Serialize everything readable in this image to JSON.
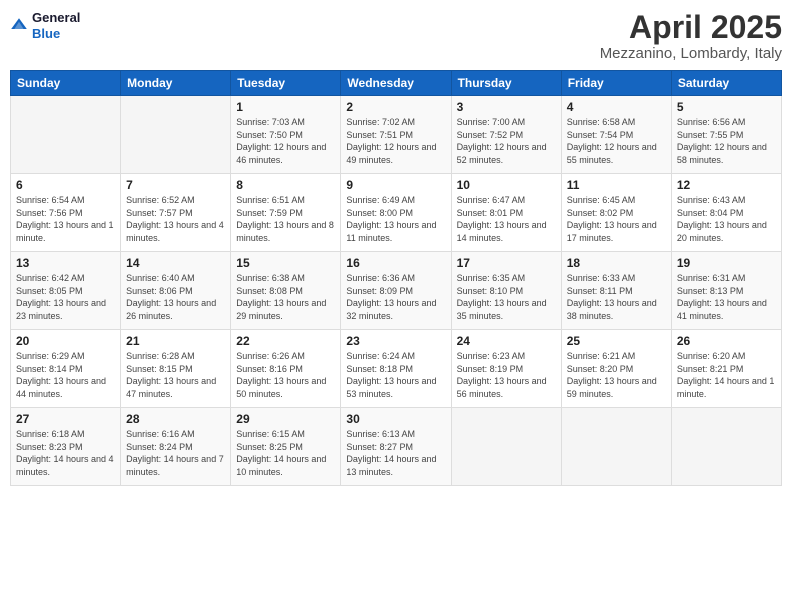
{
  "header": {
    "logo": {
      "line1": "General",
      "line2": "Blue"
    },
    "title": "April 2025",
    "location": "Mezzanino, Lombardy, Italy"
  },
  "weekdays": [
    "Sunday",
    "Monday",
    "Tuesday",
    "Wednesday",
    "Thursday",
    "Friday",
    "Saturday"
  ],
  "weeks": [
    [
      {
        "day": "",
        "info": ""
      },
      {
        "day": "",
        "info": ""
      },
      {
        "day": "1",
        "info": "Sunrise: 7:03 AM\nSunset: 7:50 PM\nDaylight: 12 hours and 46 minutes."
      },
      {
        "day": "2",
        "info": "Sunrise: 7:02 AM\nSunset: 7:51 PM\nDaylight: 12 hours and 49 minutes."
      },
      {
        "day": "3",
        "info": "Sunrise: 7:00 AM\nSunset: 7:52 PM\nDaylight: 12 hours and 52 minutes."
      },
      {
        "day": "4",
        "info": "Sunrise: 6:58 AM\nSunset: 7:54 PM\nDaylight: 12 hours and 55 minutes."
      },
      {
        "day": "5",
        "info": "Sunrise: 6:56 AM\nSunset: 7:55 PM\nDaylight: 12 hours and 58 minutes."
      }
    ],
    [
      {
        "day": "6",
        "info": "Sunrise: 6:54 AM\nSunset: 7:56 PM\nDaylight: 13 hours and 1 minute."
      },
      {
        "day": "7",
        "info": "Sunrise: 6:52 AM\nSunset: 7:57 PM\nDaylight: 13 hours and 4 minutes."
      },
      {
        "day": "8",
        "info": "Sunrise: 6:51 AM\nSunset: 7:59 PM\nDaylight: 13 hours and 8 minutes."
      },
      {
        "day": "9",
        "info": "Sunrise: 6:49 AM\nSunset: 8:00 PM\nDaylight: 13 hours and 11 minutes."
      },
      {
        "day": "10",
        "info": "Sunrise: 6:47 AM\nSunset: 8:01 PM\nDaylight: 13 hours and 14 minutes."
      },
      {
        "day": "11",
        "info": "Sunrise: 6:45 AM\nSunset: 8:02 PM\nDaylight: 13 hours and 17 minutes."
      },
      {
        "day": "12",
        "info": "Sunrise: 6:43 AM\nSunset: 8:04 PM\nDaylight: 13 hours and 20 minutes."
      }
    ],
    [
      {
        "day": "13",
        "info": "Sunrise: 6:42 AM\nSunset: 8:05 PM\nDaylight: 13 hours and 23 minutes."
      },
      {
        "day": "14",
        "info": "Sunrise: 6:40 AM\nSunset: 8:06 PM\nDaylight: 13 hours and 26 minutes."
      },
      {
        "day": "15",
        "info": "Sunrise: 6:38 AM\nSunset: 8:08 PM\nDaylight: 13 hours and 29 minutes."
      },
      {
        "day": "16",
        "info": "Sunrise: 6:36 AM\nSunset: 8:09 PM\nDaylight: 13 hours and 32 minutes."
      },
      {
        "day": "17",
        "info": "Sunrise: 6:35 AM\nSunset: 8:10 PM\nDaylight: 13 hours and 35 minutes."
      },
      {
        "day": "18",
        "info": "Sunrise: 6:33 AM\nSunset: 8:11 PM\nDaylight: 13 hours and 38 minutes."
      },
      {
        "day": "19",
        "info": "Sunrise: 6:31 AM\nSunset: 8:13 PM\nDaylight: 13 hours and 41 minutes."
      }
    ],
    [
      {
        "day": "20",
        "info": "Sunrise: 6:29 AM\nSunset: 8:14 PM\nDaylight: 13 hours and 44 minutes."
      },
      {
        "day": "21",
        "info": "Sunrise: 6:28 AM\nSunset: 8:15 PM\nDaylight: 13 hours and 47 minutes."
      },
      {
        "day": "22",
        "info": "Sunrise: 6:26 AM\nSunset: 8:16 PM\nDaylight: 13 hours and 50 minutes."
      },
      {
        "day": "23",
        "info": "Sunrise: 6:24 AM\nSunset: 8:18 PM\nDaylight: 13 hours and 53 minutes."
      },
      {
        "day": "24",
        "info": "Sunrise: 6:23 AM\nSunset: 8:19 PM\nDaylight: 13 hours and 56 minutes."
      },
      {
        "day": "25",
        "info": "Sunrise: 6:21 AM\nSunset: 8:20 PM\nDaylight: 13 hours and 59 minutes."
      },
      {
        "day": "26",
        "info": "Sunrise: 6:20 AM\nSunset: 8:21 PM\nDaylight: 14 hours and 1 minute."
      }
    ],
    [
      {
        "day": "27",
        "info": "Sunrise: 6:18 AM\nSunset: 8:23 PM\nDaylight: 14 hours and 4 minutes."
      },
      {
        "day": "28",
        "info": "Sunrise: 6:16 AM\nSunset: 8:24 PM\nDaylight: 14 hours and 7 minutes."
      },
      {
        "day": "29",
        "info": "Sunrise: 6:15 AM\nSunset: 8:25 PM\nDaylight: 14 hours and 10 minutes."
      },
      {
        "day": "30",
        "info": "Sunrise: 6:13 AM\nSunset: 8:27 PM\nDaylight: 14 hours and 13 minutes."
      },
      {
        "day": "",
        "info": ""
      },
      {
        "day": "",
        "info": ""
      },
      {
        "day": "",
        "info": ""
      }
    ]
  ]
}
